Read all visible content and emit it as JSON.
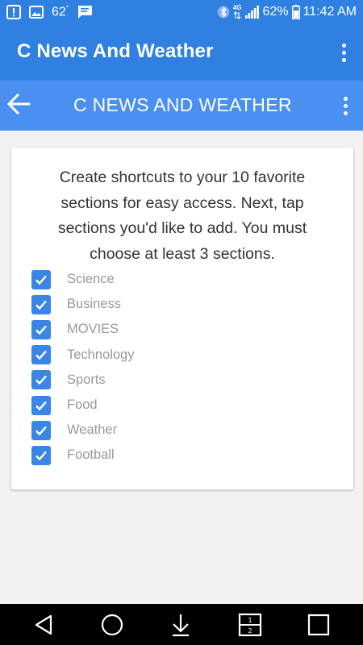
{
  "status_bar": {
    "temperature": "62",
    "degree": "°",
    "battery_percent": "62%",
    "time": "11:42 AM",
    "network": "4G"
  },
  "app_bar": {
    "title": "C News And Weather"
  },
  "sub_bar": {
    "title": "C NEWS AND WEATHER"
  },
  "card": {
    "instructions": "Create shortcuts to your 10 favorite sections for easy access. Next, tap sections you'd like to add. You must choose at least 3 sections.",
    "sections": [
      {
        "label": "Science",
        "checked": true
      },
      {
        "label": "Business",
        "checked": true
      },
      {
        "label": "MOVIES",
        "checked": true
      },
      {
        "label": "Technology",
        "checked": true
      },
      {
        "label": "Sports",
        "checked": true
      },
      {
        "label": "Food",
        "checked": true
      },
      {
        "label": "Weather",
        "checked": true
      },
      {
        "label": "Football",
        "checked": true
      }
    ]
  },
  "nav_bar": {
    "icons": [
      "back-triangle-icon",
      "home-circle-icon",
      "download-arrow-icon",
      "dual-window-icon",
      "recents-square-icon"
    ]
  },
  "colors": {
    "app_bar": "#2f80e0",
    "sub_bar": "#4a90f0",
    "checkbox": "#3a86e6",
    "label_text": "#999999",
    "background": "#f2f2f2"
  }
}
